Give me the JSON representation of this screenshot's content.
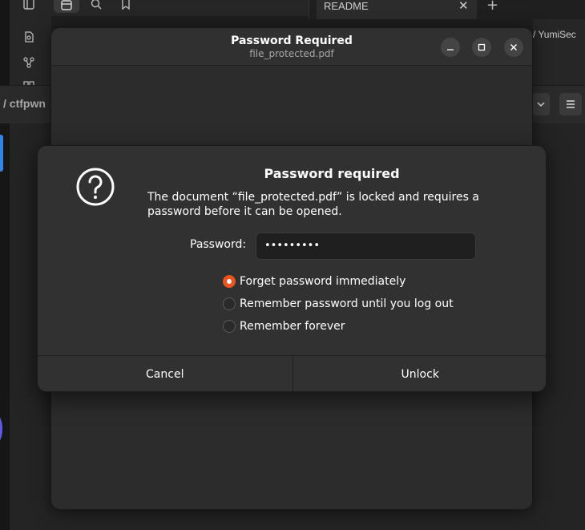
{
  "background": {
    "tab_label": "README",
    "right_crumb": "/ YumiSec",
    "path_text": "/ ctfpwn"
  },
  "window": {
    "title": "Password Required",
    "subtitle": "file_protected.pdf"
  },
  "dialog": {
    "heading": "Password required",
    "message": "The document “file_protected.pdf” is locked and requires a password before it can be opened.",
    "password_label": "Password:",
    "password_value": "•••••••••",
    "options": [
      {
        "label": "Forget password immediately",
        "selected": true
      },
      {
        "label": "Remember password until you log out",
        "selected": false
      },
      {
        "label": "Remember forever",
        "selected": false
      }
    ],
    "cancel_label": "Cancel",
    "unlock_label": "Unlock"
  },
  "colors": {
    "accent": "#e95420",
    "dialog_bg": "#313131",
    "window_bg": "#2c2c2c"
  },
  "icons": [
    "sidebar-toggle-icon",
    "files-icon",
    "search-icon",
    "bookmark-icon",
    "new-file-icon",
    "graph-icon",
    "question-icon",
    "minimize-icon",
    "maximize-icon",
    "close-icon",
    "chevron-down-icon",
    "menu-icon"
  ]
}
